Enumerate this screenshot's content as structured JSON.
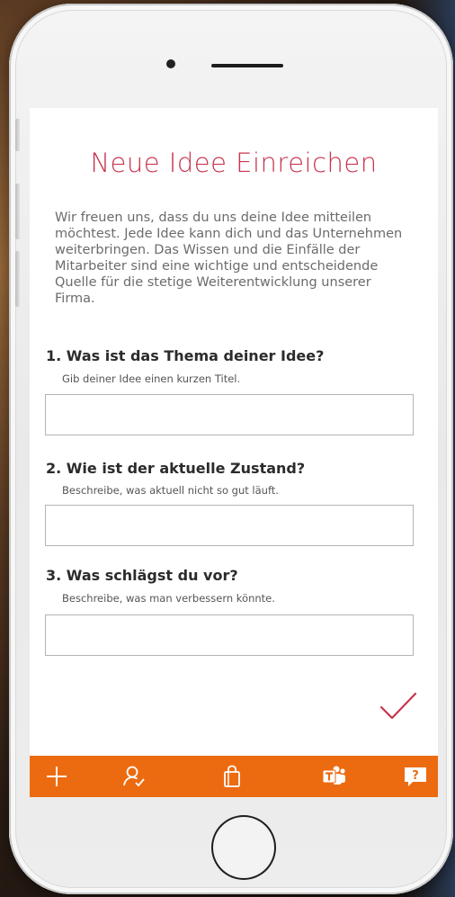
{
  "form": {
    "title": "Neue Idee Einreichen",
    "intro": "Wir freuen uns, dass du uns deine Idee mitteilen möchtest. Jede Idee kann dich und das Unternehmen weiterbringen. Das Wissen und die Einfälle der Mitarbeiter sind eine wichtige und entscheidende Quelle für die stetige Weiterentwicklung unserer Firma.",
    "questions": [
      {
        "label": "1. Was ist das Thema deiner Idee?",
        "hint": "Gib deiner Idee einen kurzen Titel.",
        "value": ""
      },
      {
        "label": "2. Wie ist der aktuelle Zustand?",
        "hint": "Beschreibe, was aktuell nicht so gut läuft.",
        "value": ""
      },
      {
        "label": "3. Was schlägst du vor?",
        "hint": "Beschreibe, was man verbessern könnte.",
        "value": ""
      }
    ]
  },
  "actions": {
    "submit_icon": "checkmark-icon"
  },
  "navbar": {
    "items": [
      {
        "icon": "plus-icon"
      },
      {
        "icon": "user-check-icon"
      },
      {
        "icon": "shopping-bag-icon"
      },
      {
        "icon": "teams-icon"
      },
      {
        "icon": "help-icon",
        "label": "?"
      }
    ]
  },
  "colors": {
    "accent": "#c8344f",
    "navbar": "#ec6b10",
    "text": "#2b2b2b",
    "muted": "#6b6b6b"
  }
}
